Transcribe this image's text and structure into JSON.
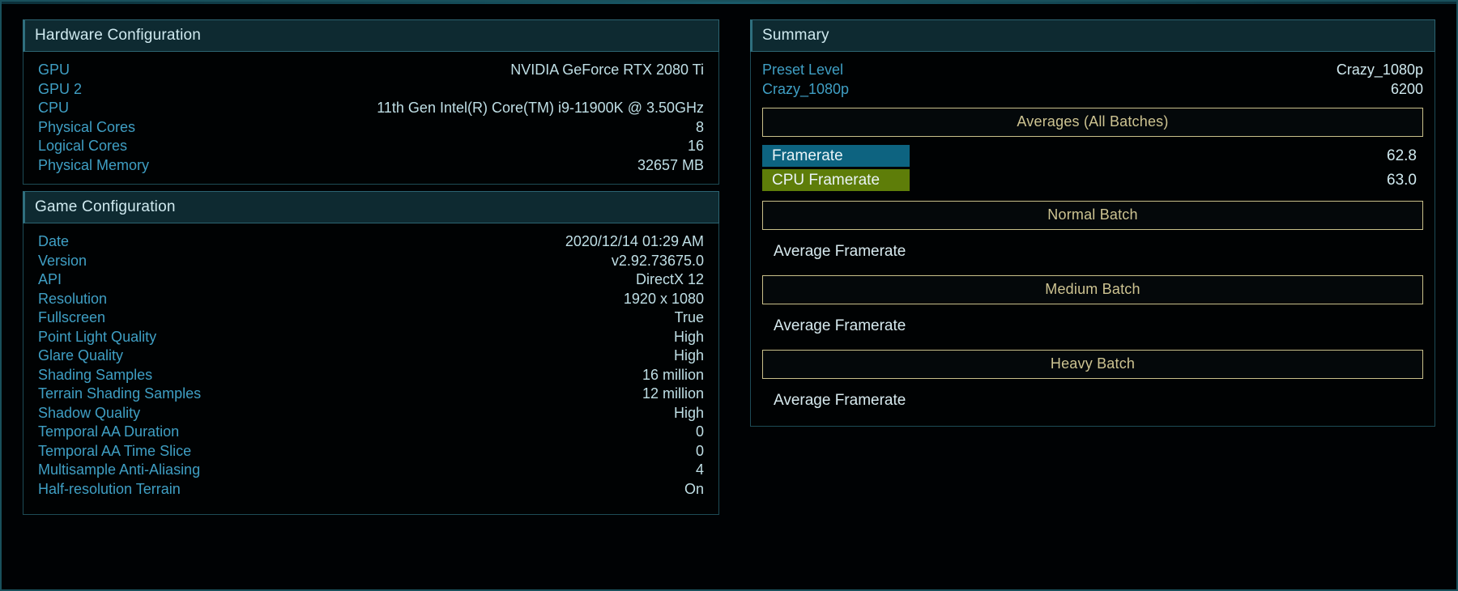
{
  "hardware": {
    "title": "Hardware Configuration",
    "rows": [
      {
        "label": "GPU",
        "value": "NVIDIA GeForce RTX 2080 Ti"
      },
      {
        "label": "GPU 2",
        "value": ""
      },
      {
        "label": "CPU",
        "value": "11th Gen Intel(R) Core(TM) i9-11900K @ 3.50GHz"
      },
      {
        "label": "Physical Cores",
        "value": "8"
      },
      {
        "label": "Logical Cores",
        "value": "16"
      },
      {
        "label": "Physical Memory",
        "value": "32657 MB"
      }
    ]
  },
  "game": {
    "title": "Game Configuration",
    "rows": [
      {
        "label": "Date",
        "value": "2020/12/14 01:29 AM"
      },
      {
        "label": "Version",
        "value": "v2.92.73675.0"
      },
      {
        "label": "API",
        "value": "DirectX 12"
      },
      {
        "label": "Resolution",
        "value": "1920 x 1080"
      },
      {
        "label": "Fullscreen",
        "value": "True"
      },
      {
        "label": "Point Light Quality",
        "value": "High"
      },
      {
        "label": "Glare Quality",
        "value": "High"
      },
      {
        "label": "Shading Samples",
        "value": "16 million"
      },
      {
        "label": "Terrain Shading Samples",
        "value": "12 million"
      },
      {
        "label": "Shadow Quality",
        "value": "High"
      },
      {
        "label": "Temporal AA Duration",
        "value": "0"
      },
      {
        "label": "Temporal AA Time Slice",
        "value": "0"
      },
      {
        "label": "Multisample Anti-Aliasing",
        "value": "4"
      },
      {
        "label": "Half-resolution Terrain",
        "value": "On"
      }
    ]
  },
  "summary": {
    "title": "Summary",
    "rows": [
      {
        "label": "Preset Level",
        "value": "Crazy_1080p"
      },
      {
        "label": "Crazy_1080p",
        "value": "6200"
      }
    ],
    "averages_banner": "Averages (All Batches)",
    "metrics": [
      {
        "label": "Framerate",
        "value": "62.8",
        "color": "#0d6380",
        "style": "teal"
      },
      {
        "label": "CPU Framerate",
        "value": "63.0",
        "color": "#5e7d09",
        "style": "olive"
      }
    ],
    "batches": [
      {
        "banner": "Normal Batch",
        "metric_label": "Average Framerate",
        "metric_value": ""
      },
      {
        "banner": "Medium Batch",
        "metric_label": "Average Framerate",
        "metric_value": ""
      },
      {
        "banner": "Heavy Batch",
        "metric_label": "Average Framerate",
        "metric_value": ""
      }
    ]
  },
  "colors": {
    "accent_border": "#19505c",
    "label_blue": "#3f9fc4",
    "value_light": "#cfe9ef",
    "banner_tan": "#cdc391",
    "framerate_teal": "#0d6380",
    "cpu_framerate_olive": "#5e7d09",
    "header_bg": "#0e2a31"
  }
}
